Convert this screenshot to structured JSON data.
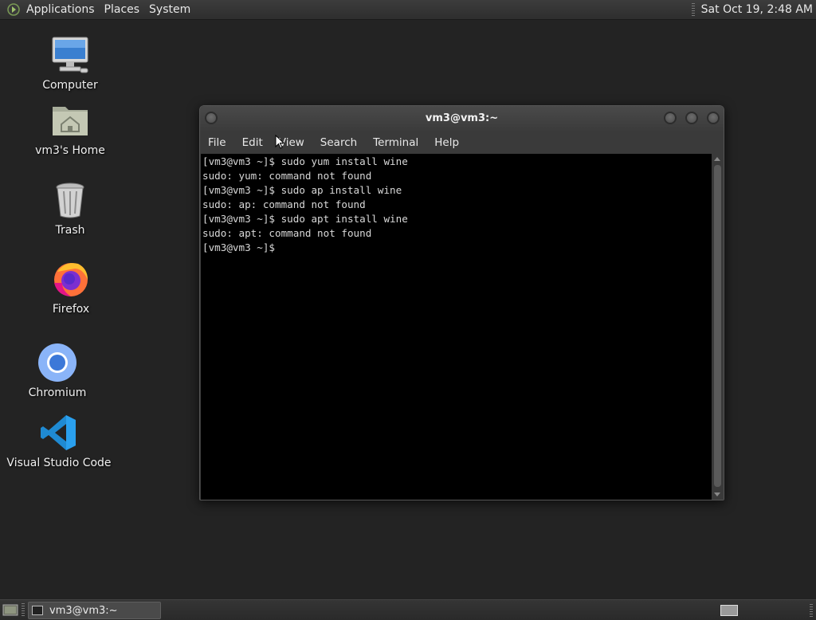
{
  "top_panel": {
    "menus": [
      "Applications",
      "Places",
      "System"
    ],
    "clock": "Sat Oct 19,  2:48 AM"
  },
  "desktop": {
    "icons": [
      {
        "label": "Computer",
        "icon": "computer-icon"
      },
      {
        "label": "vm3's Home",
        "icon": "home-folder-icon"
      },
      {
        "label": "Trash",
        "icon": "trash-icon"
      },
      {
        "label": "Firefox",
        "icon": "firefox-icon"
      },
      {
        "label": "Chromium",
        "icon": "chromium-icon"
      },
      {
        "label": "Visual Studio Code",
        "icon": "vscode-icon"
      }
    ]
  },
  "terminal": {
    "title": "vm3@vm3:~",
    "menus": [
      "File",
      "Edit",
      "View",
      "Search",
      "Terminal",
      "Help"
    ],
    "lines": [
      "[vm3@vm3 ~]$ sudo yum install wine",
      "sudo: yum: command not found",
      "[vm3@vm3 ~]$ sudo ap install wine",
      "sudo: ap: command not found",
      "[vm3@vm3 ~]$ sudo apt install wine",
      "sudo: apt: command not found",
      "[vm3@vm3 ~]$ "
    ]
  },
  "taskbar": {
    "window_label": "vm3@vm3:~"
  },
  "colors": {
    "desktop_bg": "#232323",
    "terminal_bg": "#000000",
    "terminal_fg": "#d8d8d8",
    "vscode_blue": "#1f8ad2",
    "chromium_blue": "#3c78d8"
  }
}
